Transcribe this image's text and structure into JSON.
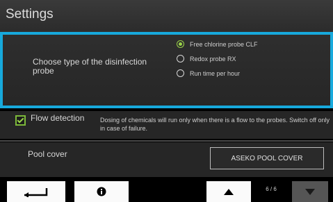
{
  "header": {
    "title": "Settings"
  },
  "probe": {
    "question": "Choose type of the disinfection probe",
    "options": [
      {
        "label": "Free chlorine probe CLF",
        "selected": true
      },
      {
        "label": "Redox probe RX",
        "selected": false
      },
      {
        "label": "Run time per hour",
        "selected": false
      }
    ]
  },
  "flow": {
    "checked": true,
    "label": "Flow detection",
    "description": "Dosing of chemicals will run only when there is a flow to the probes. Switch off only in case of failure."
  },
  "cover": {
    "label": "Pool cover",
    "value": "ASEKO POOL COVER"
  },
  "footer": {
    "page_indicator": "6 / 6",
    "icons": {
      "back": "return-arrow-icon",
      "info": "info-icon",
      "up": "arrow-up-icon",
      "down": "arrow-down-icon"
    }
  },
  "colors": {
    "highlight": "#17a9dc",
    "accent_green": "#9bd34a",
    "background": "#000000"
  }
}
